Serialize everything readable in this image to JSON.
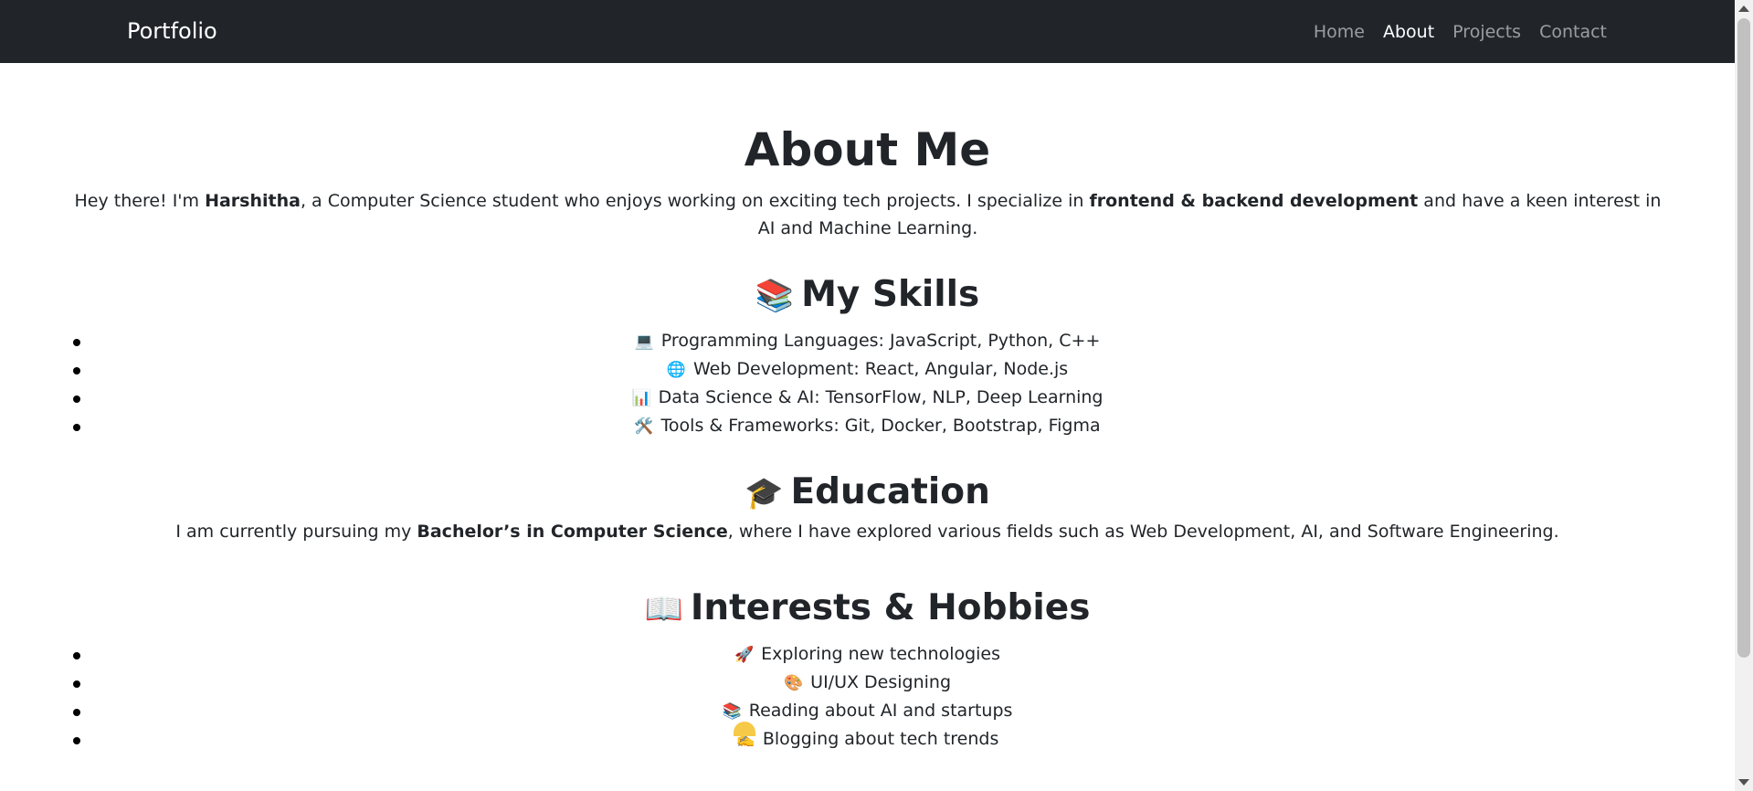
{
  "nav": {
    "brand": "Portfolio",
    "links": [
      {
        "label": "Home",
        "active": false
      },
      {
        "label": "About",
        "active": true
      },
      {
        "label": "Projects",
        "active": false
      },
      {
        "label": "Contact",
        "active": false
      }
    ]
  },
  "about": {
    "title": "About Me",
    "intro": {
      "p1": "Hey there! I'm ",
      "name": "Harshitha",
      "p2": ", a Computer Science student who enjoys working on exciting tech projects. I specialize in ",
      "focus": "frontend & backend development",
      "p3": " and have a keen interest in AI and Machine Learning."
    }
  },
  "skills": {
    "icon": "📚",
    "title": "My Skills",
    "items": [
      {
        "icon": "💻",
        "text": "Programming Languages: JavaScript, Python, C++"
      },
      {
        "icon": "🌐",
        "text": "Web Development: React, Angular, Node.js"
      },
      {
        "icon": "📊",
        "text": "Data Science & AI: TensorFlow, NLP, Deep Learning"
      },
      {
        "icon": "🛠️",
        "text": "Tools & Frameworks: Git, Docker, Bootstrap, Figma"
      }
    ]
  },
  "education": {
    "icon": "🎓",
    "title": "Education",
    "p1": "I am currently pursuing my ",
    "degree": "Bachelor’s in Computer Science",
    "p2": ", where I have explored various fields such as Web Development, AI, and Software Engineering."
  },
  "interests": {
    "icon": "📖",
    "title": "Interests & Hobbies",
    "items": [
      {
        "icon": "🚀",
        "text": "Exploring new technologies"
      },
      {
        "icon": "🎨",
        "text": "UI/UX Designing"
      },
      {
        "icon": "📚",
        "text": "Reading about AI and startups"
      },
      {
        "icon": "✍️",
        "text": "Blogging about tech trends"
      }
    ]
  }
}
